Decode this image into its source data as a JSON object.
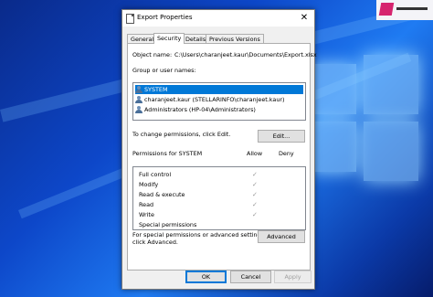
{
  "window": {
    "title": "Export Properties",
    "close_glyph": "✕"
  },
  "tabs": [
    {
      "label": "General"
    },
    {
      "label": "Security"
    },
    {
      "label": "Details"
    },
    {
      "label": "Previous Versions"
    }
  ],
  "security": {
    "object_name_label": "Object name:",
    "object_name_value": "C:\\Users\\charanjeet.kaur\\Documents\\Export.xlsx",
    "groups_label": "Group or user names:",
    "groups": [
      {
        "name": "SYSTEM",
        "icon": "users-icon",
        "selected": true
      },
      {
        "name": "charanjeet.kaur (STELLARINFO\\charanjeet.kaur)",
        "icon": "user-icon",
        "selected": false
      },
      {
        "name": "Administrators (HP-04\\Administrators)",
        "icon": "users-icon",
        "selected": false
      }
    ],
    "change_permissions_text": "To change permissions, click Edit.",
    "edit_button": "Edit...",
    "permissions_label": "Permissions for SYSTEM",
    "allow_header": "Allow",
    "deny_header": "Deny",
    "permissions": [
      {
        "name": "Full control",
        "allow": "✓",
        "deny": ""
      },
      {
        "name": "Modify",
        "allow": "✓",
        "deny": ""
      },
      {
        "name": "Read & execute",
        "allow": "✓",
        "deny": ""
      },
      {
        "name": "Read",
        "allow": "✓",
        "deny": ""
      },
      {
        "name": "Write",
        "allow": "✓",
        "deny": ""
      },
      {
        "name": "Special permissions",
        "allow": "",
        "deny": ""
      }
    ],
    "special_text_line1": "For special permissions or advanced settings,",
    "special_text_line2": "click Advanced.",
    "advanced_button": "Advanced"
  },
  "footer": {
    "ok": "OK",
    "cancel": "Cancel",
    "apply": "Apply"
  },
  "colors": {
    "accent": "#0078d7",
    "desktop": "#0d47c9"
  }
}
